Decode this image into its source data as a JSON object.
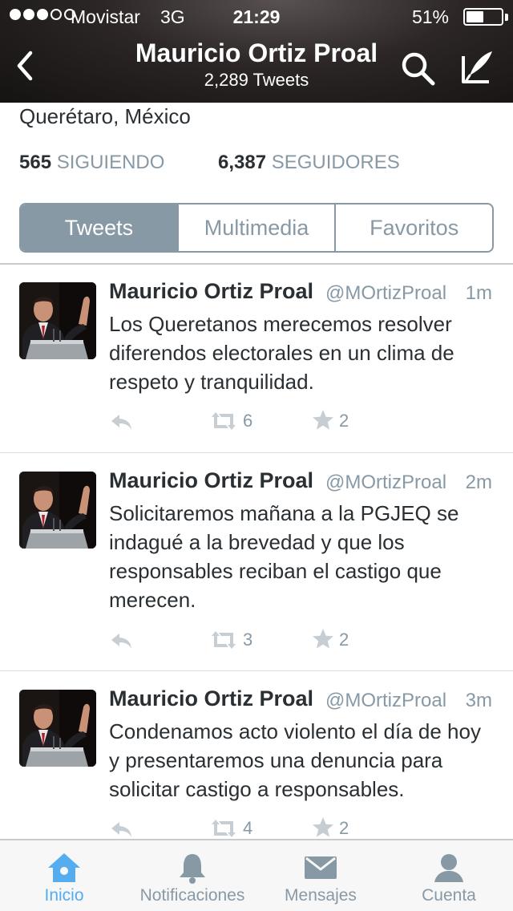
{
  "status_bar": {
    "signal_dots_filled": 3,
    "signal_dots_total": 5,
    "carrier": "Movistar",
    "network": "3G",
    "time": "21:29",
    "battery_percent": "51%",
    "battery_level": 0.51
  },
  "header": {
    "title": "Mauricio Ortiz Proal",
    "subtitle": "2,289 Tweets",
    "back_icon": "chevron-left-icon",
    "search_icon": "search-icon",
    "compose_icon": "compose-tweet-icon"
  },
  "profile": {
    "location": "Querétaro, México",
    "following_count": "565",
    "following_label": "SIGUIENDO",
    "followers_count": "6,387",
    "followers_label": "SEGUIDORES"
  },
  "tabs": {
    "tweets": "Tweets",
    "media": "Multimedia",
    "favorites": "Favoritos",
    "active": "tweets"
  },
  "tweets": [
    {
      "name": "Mauricio Ortiz Proal",
      "handle": "@MOrtizProal",
      "time": "1m",
      "text": "Los Queretanos merecemos resolver diferendos electorales en un clima de respeto y tranquilidad.",
      "retweets": "6",
      "favorites": "2"
    },
    {
      "name": "Mauricio Ortiz Proal",
      "handle": "@MOrtizProal",
      "time": "2m",
      "text": "Solicitaremos mañana a la PGJEQ se indagué a la brevedad y que los responsables reciban el castigo que merecen.",
      "retweets": "3",
      "favorites": "2"
    },
    {
      "name": "Mauricio Ortiz Proal",
      "handle": "@MOrtizProal",
      "time": "3m",
      "text": "Condenamos acto violento el día de hoy y presentaremos una denuncia para solicitar castigo a responsables.",
      "retweets": "4",
      "favorites": "2"
    }
  ],
  "tabbar": {
    "home": "Inicio",
    "notifications": "Notificaciones",
    "messages": "Mensajes",
    "account": "Cuenta",
    "active": "home"
  },
  "colors": {
    "accent_blue": "#55acee",
    "muted_gray": "#8899a6",
    "text_dark": "#292f33"
  }
}
